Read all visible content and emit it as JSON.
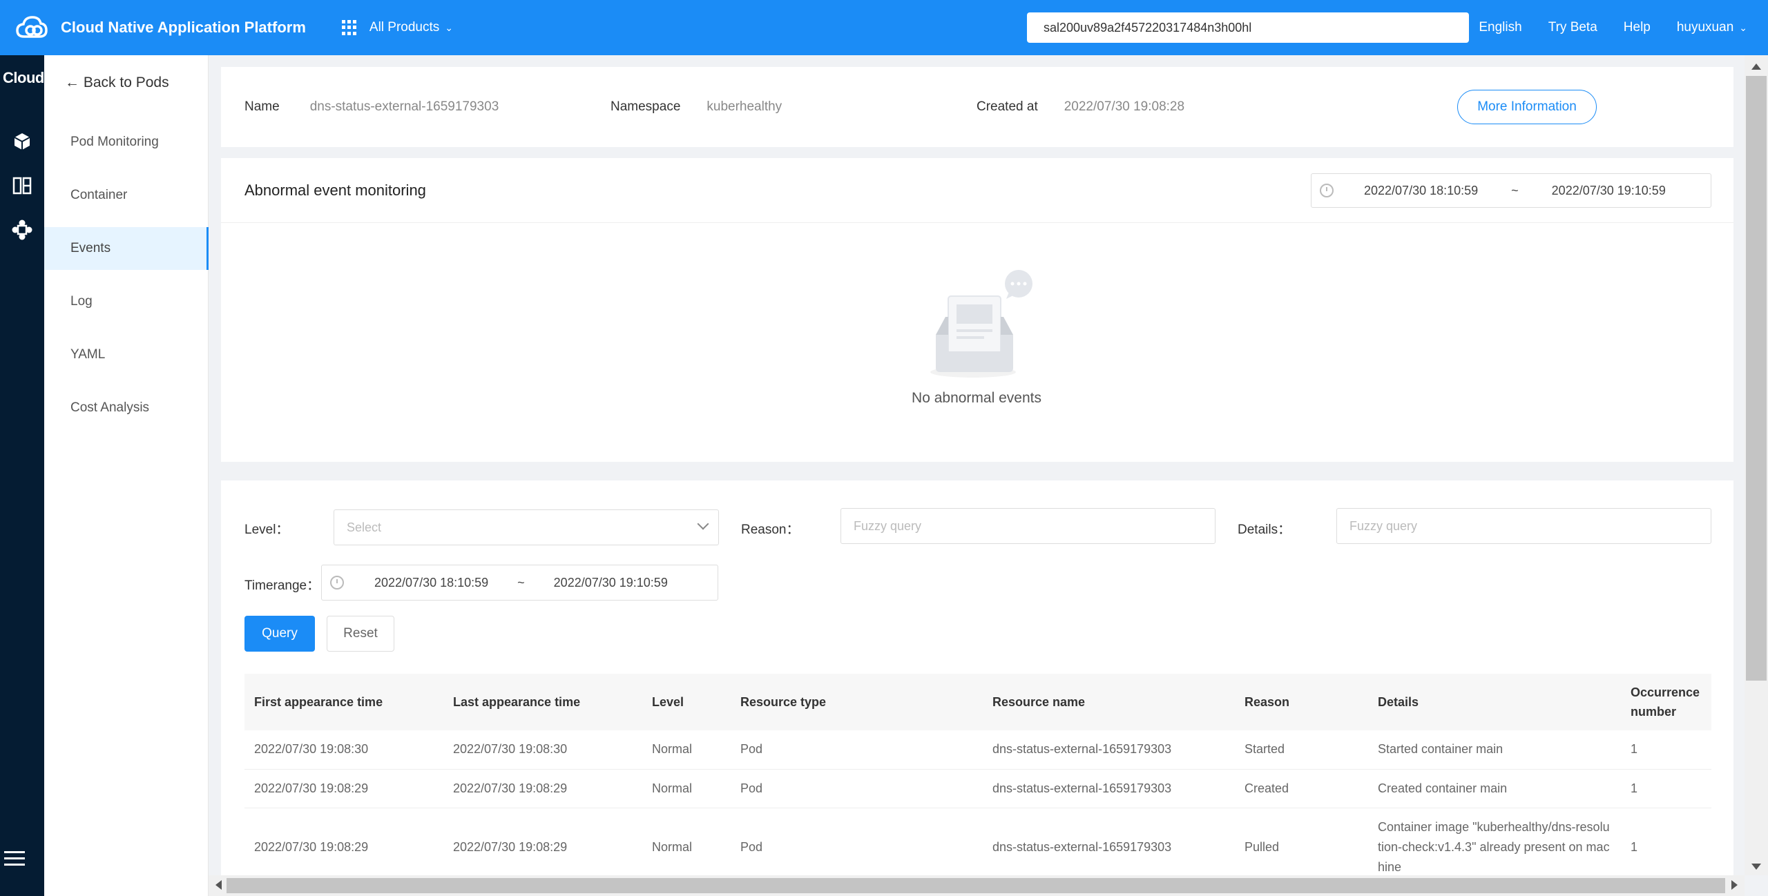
{
  "header": {
    "brand": "Cloud Native Application Platform",
    "all_products": "All Products",
    "search_value": "sal200uv89a2f457220317484n3h00hl",
    "language": "English",
    "try_beta": "Try Beta",
    "help": "Help",
    "user": "huyuxuan"
  },
  "rail": {
    "title": "Cloud",
    "icons": [
      "box-icon",
      "dashboard-icon",
      "cluster-icon",
      "menu-icon"
    ]
  },
  "subnav": {
    "back": "← Back to Pods",
    "items": [
      {
        "label": "Pod Monitoring"
      },
      {
        "label": "Container"
      },
      {
        "label": "Events"
      },
      {
        "label": "Log"
      },
      {
        "label": "YAML"
      },
      {
        "label": "Cost Analysis"
      }
    ],
    "active": "Events"
  },
  "info": {
    "name_label": "Name",
    "name_value": "dns-status-external-1659179303",
    "namespace_label": "Namespace",
    "namespace_value": "kuberhealthy",
    "created_label": "Created at",
    "created_value": "2022/07/30 19:08:28",
    "more_info": "More Information"
  },
  "abnormal": {
    "title": "Abnormal event monitoring",
    "range_from": "2022/07/30 18:10:59",
    "range_sep": "~",
    "range_to": "2022/07/30 19:10:59",
    "empty_text": "No abnormal events"
  },
  "filter": {
    "level_label": "Level",
    "level_placeholder": "Select",
    "reason_label": "Reason",
    "reason_placeholder": "Fuzzy query",
    "details_label": "Details",
    "details_placeholder": "Fuzzy query",
    "timerange_label": "Timerange",
    "range_from": "2022/07/30 18:10:59",
    "range_sep": "~",
    "range_to": "2022/07/30 19:10:59",
    "query": "Query",
    "reset": "Reset"
  },
  "table": {
    "columns": [
      "First appearance time",
      "Last appearance time",
      "Level",
      "Resource type",
      "Resource name",
      "Reason",
      "Details",
      "Occurrence number"
    ],
    "rows": [
      [
        "2022/07/30 19:08:30",
        "2022/07/30 19:08:30",
        "Normal",
        "Pod",
        "dns-status-external-1659179303",
        "Started",
        "Started container main",
        "1"
      ],
      [
        "2022/07/30 19:08:29",
        "2022/07/30 19:08:29",
        "Normal",
        "Pod",
        "dns-status-external-1659179303",
        "Created",
        "Created container main",
        "1"
      ],
      [
        "2022/07/30 19:08:29",
        "2022/07/30 19:08:29",
        "Normal",
        "Pod",
        "dns-status-external-1659179303",
        "Pulled",
        "Container image \"kuberhealthy/dns-resolution-check:v1.4.3\" already present on machine",
        "1"
      ]
    ]
  },
  "colors": {
    "primary": "#1b8cf6",
    "rail": "#051c33",
    "active_bg": "#e6f4ff"
  }
}
